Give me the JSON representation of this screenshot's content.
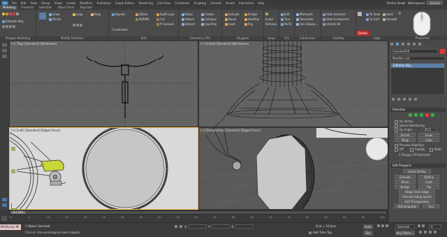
{
  "menu": {
    "app_icon": "3ds",
    "items": [
      "File",
      "Edit",
      "Tools",
      "Group",
      "Views",
      "Create",
      "Modifiers",
      "Animation",
      "Graph Editors",
      "Rendering",
      "Civil View",
      "Customize",
      "Scripting",
      "Content",
      "Arnold",
      "Interactive",
      "Help"
    ],
    "user": "Dmitry Gnatt",
    "workspace_label": "Workspaces:",
    "workspace_value": "Default"
  },
  "ribbon": {
    "tabs": [
      "Modeling",
      "Freeform",
      "Selection",
      "Object Paint",
      "Populate"
    ],
    "active_tab": "Modeling",
    "panels": {
      "polygon_modeling": {
        "label": "Polygon Modeling",
        "edit_poly": "Editable Poly"
      },
      "modify_selection": {
        "label": "Modify Selection",
        "items": [
          "Grow",
          "Shrink",
          "Loop",
          "Ring"
        ]
      },
      "edit": {
        "label": "Edit",
        "items": [
          "Repeat",
          "QSlice",
          "Swift Loop",
          "NURMS",
          "Cut",
          "P Connect",
          "Constraints"
        ]
      },
      "geometry": {
        "label": "Geometry (All)",
        "items": [
          "Relax",
          "Create",
          "Attach",
          "Detach",
          "Collapse",
          "Cap Poly"
        ]
      },
      "polygons": {
        "label": "Polygons",
        "items": [
          "Extrude",
          "Bevel",
          "Inset",
          "Bridge",
          "GeoPoly",
          "Flip"
        ]
      },
      "loops": {
        "label": "Loops",
        "items": [
          "Insert",
          "Remove"
        ]
      },
      "tris": {
        "label": "Tris",
        "items": [
          "Edit",
          "Turn",
          "Re-Tri"
        ]
      },
      "subdivision": {
        "label": "Subdivision",
        "items": [
          "MSmooth",
          "Tessellate",
          "Use Displac..."
        ]
      },
      "visibility": {
        "label": "Visibility",
        "items": [
          "Hide Selected",
          "Hide Unselected",
          "Unhide All"
        ]
      },
      "align": {
        "label": "Align",
        "items": [
          "To View",
          "To Grid"
        ]
      },
      "properties": {
        "label": "Properties",
        "items": [
          "Hard",
          "Smooth"
        ]
      },
      "delete_label": "Delete"
    }
  },
  "viewports": {
    "top": "[+] [Top] [Standard] [Wireframe]",
    "front": "[+] [Front] [Standard] [Wireframe]",
    "left": "[+] [Left] [Standard] [Edged Faces]",
    "persp": "[+] [Perspective] [Standard] [Edged Faces]"
  },
  "command_panel": {
    "object_name": "Cylinder010",
    "modifier_list": "Modifier List",
    "stack_item": "Editable Poly",
    "selection": {
      "header": "Selection",
      "checks": [
        "By Vertex",
        "Ignore Backfacing",
        "By Angle:",
        "Preview Selection"
      ],
      "by_angle_value": "45.0",
      "buttons": [
        "Shrink",
        "Grow",
        "Ring",
        "Loop"
      ],
      "preview_opts": [
        "Off",
        "SubObj",
        "Multi"
      ],
      "status": "1 Polygon 56 Selected"
    },
    "edit_polygons": {
      "header": "Edit Polygons",
      "insert_vertex": "Insert Vertex",
      "buttons": [
        "Extrude",
        "Outline",
        "Bevel",
        "Inset",
        "Bridge",
        "Flip"
      ],
      "hinge": "Hinge From Edge",
      "extrude_spline": "Extrude Along Spline",
      "edit_tri": "Edit Triangulation",
      "retri": "Retriangulate",
      "turn": "Turn"
    }
  },
  "timeline": {
    "frame_label": "0 / 100",
    "ticks": [
      "0",
      "5",
      "10",
      "15",
      "20",
      "25",
      "30",
      "35",
      "40",
      "45",
      "50",
      "55",
      "60",
      "65",
      "70",
      "75",
      "80",
      "85",
      "90",
      "95",
      "100"
    ]
  },
  "status": {
    "maxscript": "MAXScript Mi",
    "selected": "1 Object Selected",
    "hint": "Click or click-and-drag to select objects",
    "x_label": "X:",
    "y_label": "Y:",
    "z_label": "Z:",
    "grid": "Grid = 10,0cm",
    "add_time_tag": "Add Time Tag",
    "auto_key": "Auto Key",
    "set_key": "Set Key",
    "selected_dropdown": "Selected",
    "key_filters": "Key Filters...",
    "frame": "0"
  },
  "colors": {
    "delete_red": "#c62828",
    "accent_yellow": "#e8c020",
    "active_border": "#f0c040",
    "green_icon": "#3ea84a"
  }
}
